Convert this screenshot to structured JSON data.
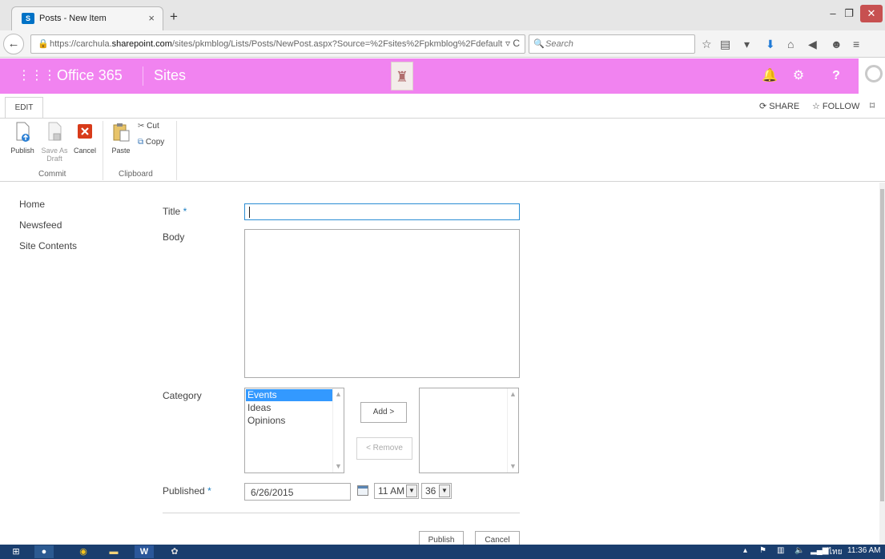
{
  "browser": {
    "tab_title": "Posts - New Item",
    "tab_favicon": "S",
    "tab_close": "×",
    "new_tab": "+",
    "url_prefix": "https://carchula.",
    "url_domain": "sharepoint.com",
    "url_suffix": "/sites/pkmblog/Lists/Posts/NewPost.aspx?Source=%2Fsites%2Fpkmblog%2Fdefault",
    "search_placeholder": "Search",
    "window_controls": {
      "minimize": "–",
      "restore": "❐",
      "close": "✕"
    },
    "toolbar_icons": [
      "star-icon",
      "reading-list-icon",
      "pocket-icon",
      "download-icon",
      "home-icon",
      "share-icon",
      "chat-icon",
      "menu-icon"
    ]
  },
  "suitebar": {
    "brand": "Office 365",
    "sites_link": "Sites",
    "background": "#f183f0"
  },
  "ribbon": {
    "tab_edit": "EDIT",
    "share": "SHARE",
    "follow": "FOLLOW",
    "commit_group": {
      "label": "Commit",
      "publish": "Publish",
      "save_as_draft_line1": "Save As",
      "save_as_draft_line2": "Draft",
      "cancel": "Cancel"
    },
    "clipboard_group": {
      "label": "Clipboard",
      "paste": "Paste",
      "cut": "Cut",
      "copy": "Copy"
    }
  },
  "leftnav": {
    "items": [
      {
        "label": "Home"
      },
      {
        "label": "Newsfeed"
      },
      {
        "label": "Site Contents"
      }
    ]
  },
  "form": {
    "title_label": "Title",
    "title_value": "",
    "body_label": "Body",
    "category_label": "Category",
    "required_marker": "*",
    "category_options": [
      {
        "label": "Events",
        "selected": true
      },
      {
        "label": "Ideas",
        "selected": false
      },
      {
        "label": "Opinions",
        "selected": false
      }
    ],
    "add_button": "Add >",
    "remove_button": "< Remove",
    "published_label": "Published",
    "published_date": "6/26/2015",
    "published_hour": "11 AM",
    "published_minute": "36",
    "publish_button": "Publish",
    "cancel_button": "Cancel"
  },
  "taskbar": {
    "time": "11:36 AM",
    "lang": "ไทย"
  }
}
